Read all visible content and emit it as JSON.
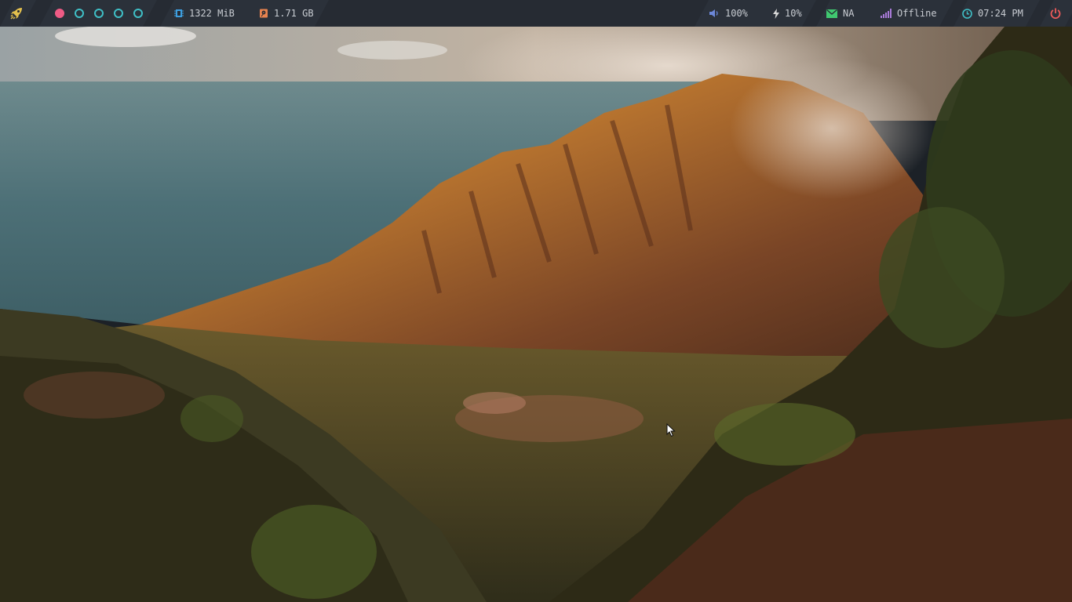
{
  "launcher": {
    "icon": "rocket-icon"
  },
  "workspaces": [
    {
      "name": "workspace-1",
      "active": true
    },
    {
      "name": "workspace-2",
      "active": false
    },
    {
      "name": "workspace-3",
      "active": false
    },
    {
      "name": "workspace-4",
      "active": false
    },
    {
      "name": "workspace-5",
      "active": false
    }
  ],
  "status": {
    "memory": {
      "icon": "memory-icon",
      "value": "1322 MiB",
      "color": "#3d9fe0"
    },
    "disk": {
      "icon": "disk-icon",
      "value": "1.71 GB",
      "color": "#e8834f"
    },
    "volume": {
      "icon": "volume-icon",
      "value": "100%",
      "color": "#6c87d8"
    },
    "brightness": {
      "icon": "lightning-icon",
      "value": "10%",
      "color": "#d8d8d8"
    },
    "mail": {
      "icon": "mail-icon",
      "value": "NA",
      "color": "#40c870"
    },
    "network": {
      "icon": "signal-icon",
      "value": "Offline",
      "color": "#a87ad8"
    },
    "clock": {
      "icon": "clock-icon",
      "value": "07:24 PM",
      "color": "#3fbfc6"
    },
    "power": {
      "icon": "power-icon",
      "color": "#ef5b5b"
    }
  },
  "colors": {
    "bar_bg": "#262b33",
    "text": "#c8ccd2",
    "accent_active": "#ef5b85",
    "accent": "#3fbfc6"
  },
  "wallpaper": {
    "icon": "landscape-wallpaper"
  }
}
